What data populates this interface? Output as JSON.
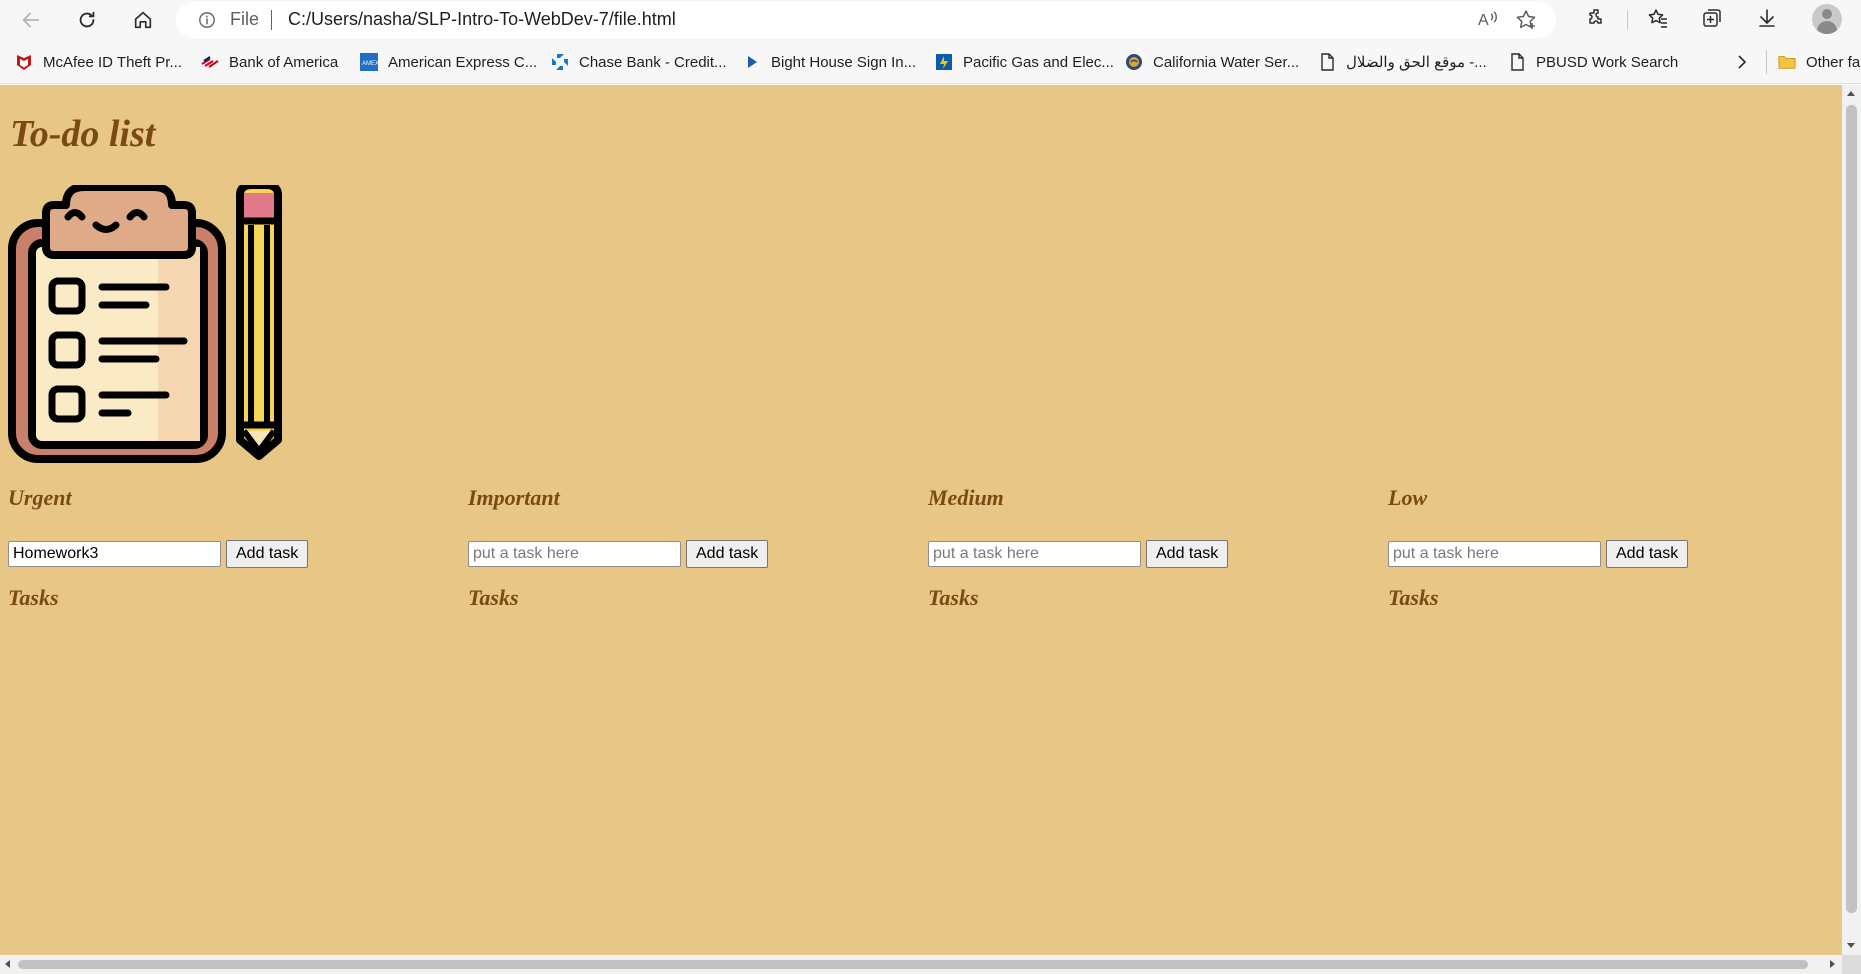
{
  "browser": {
    "address": {
      "scheme": "File",
      "url": "C:/Users/nasha/SLP-Intro-To-WebDev-7/file.html"
    },
    "bookmarks": [
      {
        "label": "McAfee ID Theft Pr...",
        "icon": "mcafee-icon"
      },
      {
        "label": "Bank of America",
        "icon": "bank-of-america-icon"
      },
      {
        "label": "American Express C...",
        "icon": "amex-icon"
      },
      {
        "label": "Chase Bank - Credit...",
        "icon": "chase-icon"
      },
      {
        "label": "Bight House Sign In...",
        "icon": "play-icon"
      },
      {
        "label": "Pacific Gas and Elec...",
        "icon": "pge-icon"
      },
      {
        "label": "California Water Ser...",
        "icon": "cal-water-icon"
      },
      {
        "label": "موقع الحق والضلال -...",
        "icon": "page-icon"
      },
      {
        "label": "PBUSD Work Search",
        "icon": "page-icon"
      }
    ],
    "other_favorites": "Other fa"
  },
  "page": {
    "title": "To-do list",
    "columns": [
      {
        "heading": "Urgent",
        "input_value": "Homework3",
        "placeholder": "put a task here",
        "button": "Add task",
        "tasks_heading": "Tasks"
      },
      {
        "heading": "Important",
        "input_value": "",
        "placeholder": "put a task here",
        "button": "Add task",
        "tasks_heading": "Tasks"
      },
      {
        "heading": "Medium",
        "input_value": "",
        "placeholder": "put a task here",
        "button": "Add task",
        "tasks_heading": "Tasks"
      },
      {
        "heading": "Low",
        "input_value": "",
        "placeholder": "put a task here",
        "button": "Add task",
        "tasks_heading": "Tasks"
      }
    ]
  },
  "colors": {
    "page_background": "#e8c686",
    "heading": "#7a4a14"
  }
}
